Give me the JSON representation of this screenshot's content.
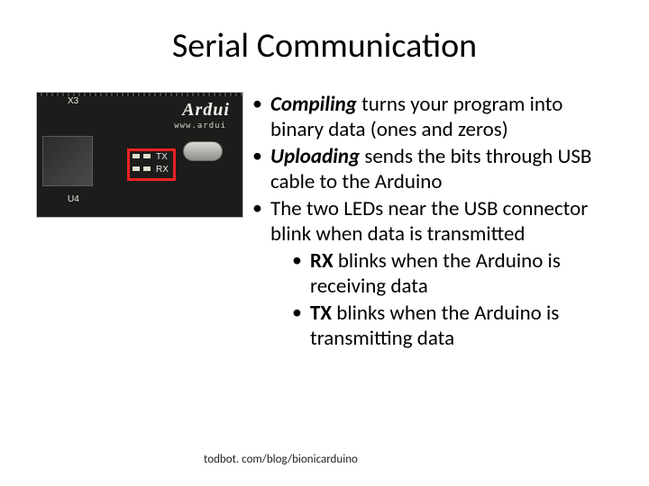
{
  "title": "Serial Communication",
  "image": {
    "silkscreen": {
      "x3": "X3",
      "brand": "Ardui",
      "url": "www.ardui",
      "u4": "U4"
    },
    "labels": {
      "tx": "TX",
      "rx": "RX"
    }
  },
  "bullets": {
    "b1_strong": "Compiling",
    "b1_rest": " turns your program into binary data (ones and zeros)",
    "b2_strong": "Uploading",
    "b2_rest": " sends the bits through USB cable to the Arduino",
    "b3": "The two LEDs near the USB connector blink when data is transmitted",
    "s1_strong": "RX",
    "s1_rest": " blinks when the Arduino is receiving data",
    "s2_strong": "TX",
    "s2_rest": " blinks when the Arduino is transmitting data"
  },
  "footer": "todbot. com/blog/bionicarduino"
}
